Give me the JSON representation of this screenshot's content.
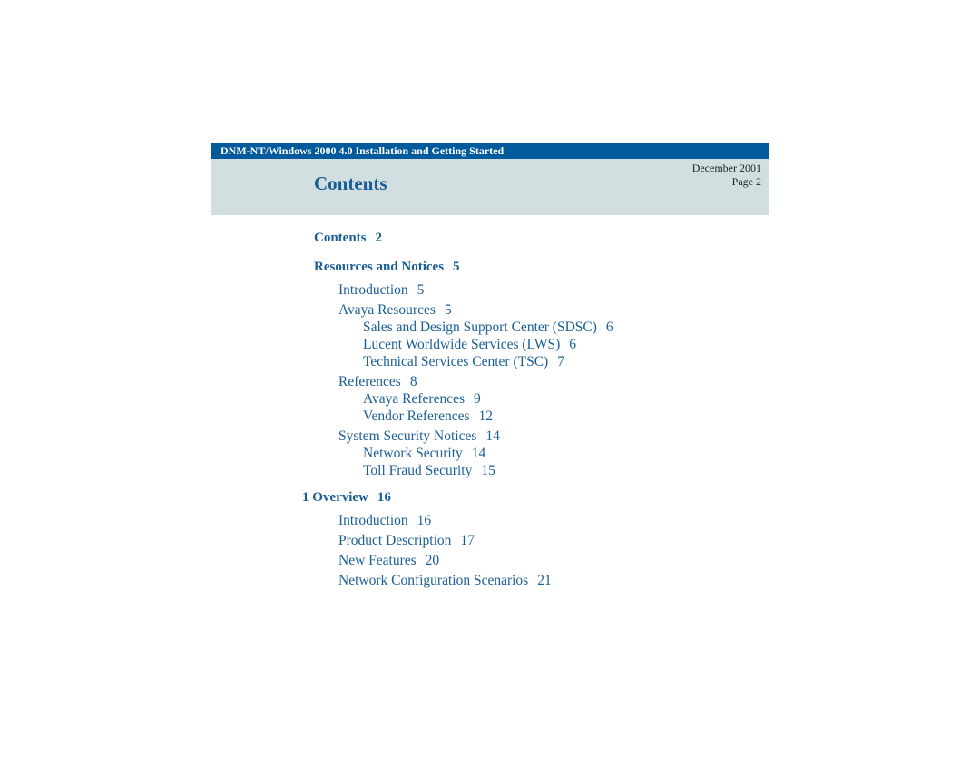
{
  "header": {
    "doc_title": "DNM-NT/Windows 2000 4.0 Installation and Getting Started",
    "page_title": "Contents",
    "date": "December 2001",
    "page": "Page 2"
  },
  "colors": {
    "header_bar": "#005a9c",
    "panel": "#d2dfe0",
    "link_text": "#1b5e96"
  },
  "toc": [
    {
      "level": 0,
      "title": "Contents",
      "page": "2"
    },
    {
      "level": 0,
      "title": "Resources and Notices",
      "page": "5"
    },
    {
      "level": 1,
      "title": "Introduction",
      "page": "5"
    },
    {
      "level": 1,
      "title": "Avaya Resources",
      "page": "5"
    },
    {
      "level": 2,
      "title": "Sales and Design Support Center (SDSC)",
      "page": "6"
    },
    {
      "level": 2,
      "title": "Lucent Worldwide Services (LWS)",
      "page": "6"
    },
    {
      "level": 2,
      "title": "Technical Services Center (TSC)",
      "page": "7"
    },
    {
      "level": 1,
      "title": "References",
      "page": "8"
    },
    {
      "level": 2,
      "title": "Avaya References",
      "page": "9"
    },
    {
      "level": 2,
      "title": "Vendor References",
      "page": "12"
    },
    {
      "level": 1,
      "title": "System Security Notices",
      "page": "14"
    },
    {
      "level": 2,
      "title": "Network Security",
      "page": "14"
    },
    {
      "level": 2,
      "title": "Toll Fraud Security",
      "page": "15"
    },
    {
      "level": 0,
      "title": "1 Overview",
      "page": "16"
    },
    {
      "level": 1,
      "title": "Introduction",
      "page": "16"
    },
    {
      "level": 1,
      "title": "Product Description",
      "page": "17"
    },
    {
      "level": 1,
      "title": "New Features",
      "page": "20"
    },
    {
      "level": 1,
      "title": "Network Configuration Scenarios",
      "page": "21"
    }
  ]
}
